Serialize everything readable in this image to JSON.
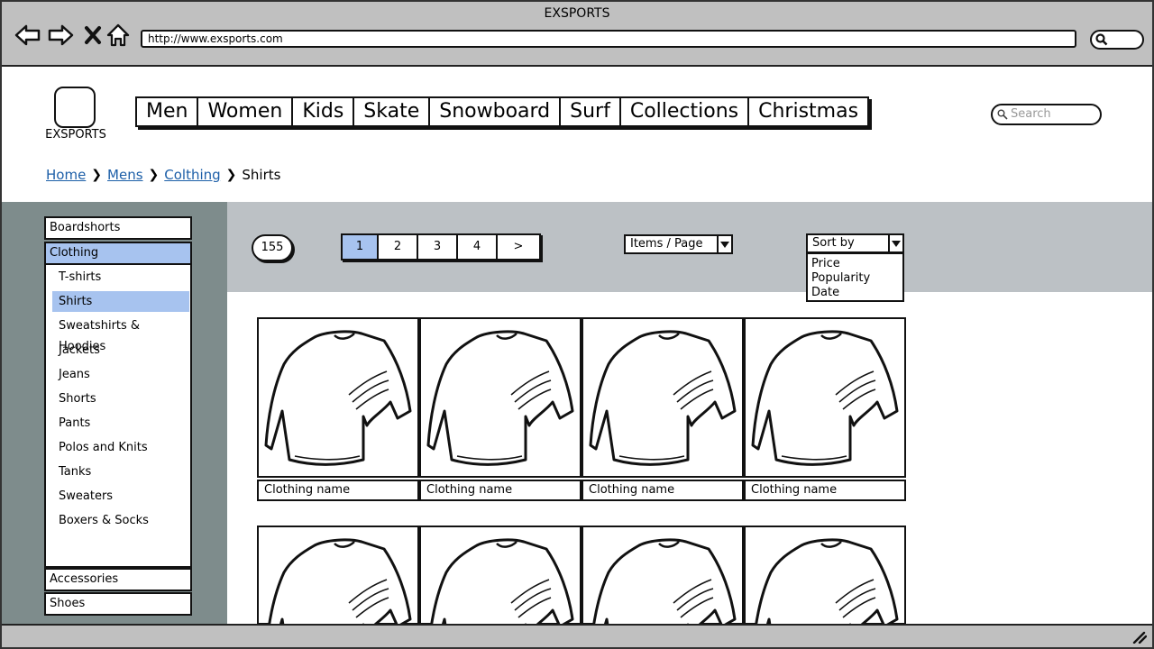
{
  "window": {
    "title": "EXSPORTS"
  },
  "browser": {
    "url": "http://www.exsports.com"
  },
  "header": {
    "logo_text": "EXSPORTS",
    "nav": [
      "Men",
      "Women",
      "Kids",
      "Skate",
      "Snowboard",
      "Surf",
      "Collections",
      "Christmas"
    ],
    "search_placeholder": "Search"
  },
  "breadcrumb": {
    "items": [
      "Home",
      "Mens",
      "Colthing"
    ],
    "current": "Shirts"
  },
  "sidebar": {
    "categories": [
      "Boardshorts",
      "Clothing",
      "Accessories",
      "Shoes"
    ],
    "active_category": "Clothing",
    "subcategories": [
      "T-shirts",
      "Shirts",
      "Sweatshirts & Hoodies",
      "Jackets",
      "Jeans",
      "Shorts",
      "Pants",
      "Polos and Knits",
      "Tanks",
      "Sweaters",
      "Boxers & Socks"
    ],
    "active_subcategory": "Shirts"
  },
  "toolbar": {
    "result_count": "155",
    "pages": [
      "1",
      "2",
      "3",
      "4",
      ">"
    ],
    "current_page": "1",
    "items_per_page_label": "Items / Page",
    "sort_label": "Sort by",
    "sort_options": [
      "Price",
      "Popularity",
      "Date"
    ]
  },
  "products": [
    {
      "name": "Clothing name"
    },
    {
      "name": "Clothing name"
    },
    {
      "name": "Clothing name"
    },
    {
      "name": "Clothing name"
    },
    {
      "name": ""
    },
    {
      "name": ""
    },
    {
      "name": ""
    },
    {
      "name": ""
    }
  ],
  "colors": {
    "accent": "#a7c3ef",
    "link": "#1d5fa8",
    "sidebar_bg": "#7e8c8c",
    "band_bg": "#bcc1c5",
    "chrome_bg": "#c0c0c0"
  }
}
